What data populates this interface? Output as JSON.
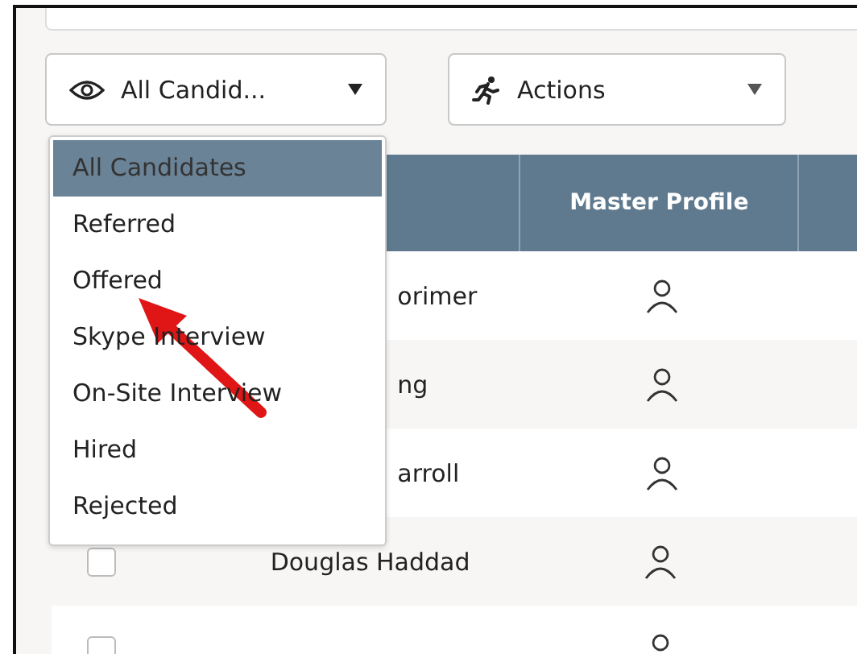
{
  "toolbar": {
    "filter_button": "All Candid...",
    "actions_button": "Actions"
  },
  "filter_menu": [
    {
      "label": "All Candidates",
      "selected": true
    },
    {
      "label": "Referred",
      "selected": false
    },
    {
      "label": "Offered",
      "selected": false
    },
    {
      "label": "Skype Interview",
      "selected": false
    },
    {
      "label": "On-Site Interview",
      "selected": false
    },
    {
      "label": "Hired",
      "selected": false
    },
    {
      "label": "Rejected",
      "selected": false
    }
  ],
  "table": {
    "columns": [
      "Master Profile"
    ],
    "rows": [
      {
        "kind": "covered",
        "name": "orimer"
      },
      {
        "kind": "covered",
        "name": "ng"
      },
      {
        "kind": "covered",
        "name": "arroll"
      },
      {
        "kind": "full",
        "name": "Douglas Haddad",
        "checked": false
      },
      {
        "kind": "cut",
        "checked": false
      }
    ]
  }
}
